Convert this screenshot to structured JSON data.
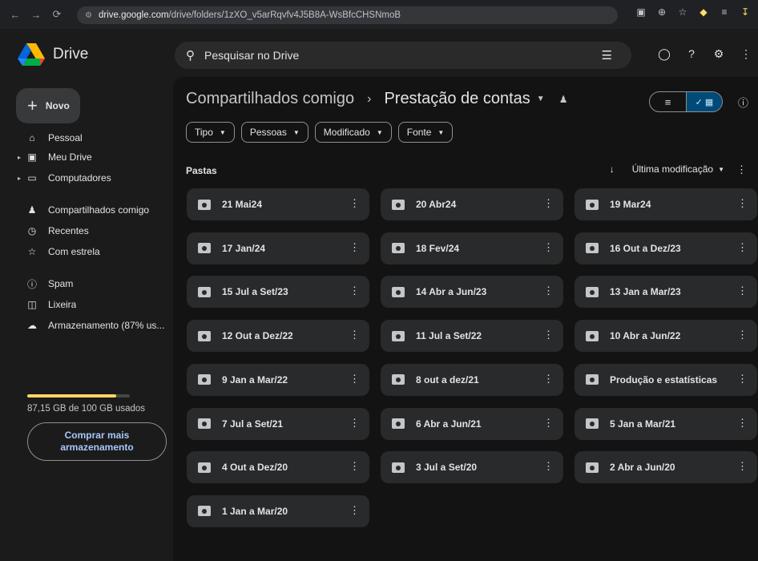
{
  "browser": {
    "url_host": "drive.google.com",
    "url_path": "/drive/folders/1zXO_v5arRqvfv4J5B8A-WsBfcCHSNmoB",
    "back_icon": "arrow-left-icon",
    "forward_icon": "arrow-right-icon",
    "reload_icon": "reload-icon"
  },
  "header": {
    "app_name": "Drive",
    "search_placeholder": "Pesquisar no Drive"
  },
  "sidebar": {
    "new_label": "Novo",
    "items": [
      {
        "label": "Pessoal",
        "icon": "home-icon"
      },
      {
        "label": "Meu Drive",
        "icon": "drive-icon"
      },
      {
        "label": "Computadores",
        "icon": "computer-icon"
      },
      {
        "label": "Compartilhados comigo",
        "icon": "people-icon"
      },
      {
        "label": "Recentes",
        "icon": "clock-icon"
      },
      {
        "label": "Com estrela",
        "icon": "star-icon"
      },
      {
        "label": "Spam",
        "icon": "spam-icon"
      },
      {
        "label": "Lixeira",
        "icon": "trash-icon"
      },
      {
        "label": "Armazenamento (87% us...",
        "icon": "cloud-icon"
      }
    ],
    "storage_fraction": 0.87,
    "storage_text": "87,15 GB de 100 GB usados",
    "buy_label_1": "Comprar mais",
    "buy_label_2": "armazenamento"
  },
  "main": {
    "breadcrumb_parent": "Compartilhados comigo",
    "breadcrumb_current": "Prestação de contas",
    "filters": [
      "Tipo",
      "Pessoas",
      "Modificado",
      "Fonte"
    ],
    "section_title": "Pastas",
    "sort_label": "Última modificação",
    "folders": [
      "21 Mai24",
      "20 Abr24",
      "19 Mar24",
      "17 Jan/24",
      "18 Fev/24",
      "16 Out a Dez/23",
      "15 Jul a Set/23",
      "14 Abr a Jun/23",
      "13 Jan a Mar/23",
      "12 Out a Dez/22",
      "11 Jul a Set/22",
      "10 Abr a Jun/22",
      "9 Jan a Mar/22",
      "8 out a dez/21",
      "Produção e estatísticas",
      "7 Jul a Set/21",
      "6 Abr a Jun/21",
      "5 Jan a Mar/21",
      "4 Out a Dez/20",
      "3 Jul a Set/20",
      "2 Abr a Jun/20",
      "1 Jan a Mar/20"
    ]
  }
}
